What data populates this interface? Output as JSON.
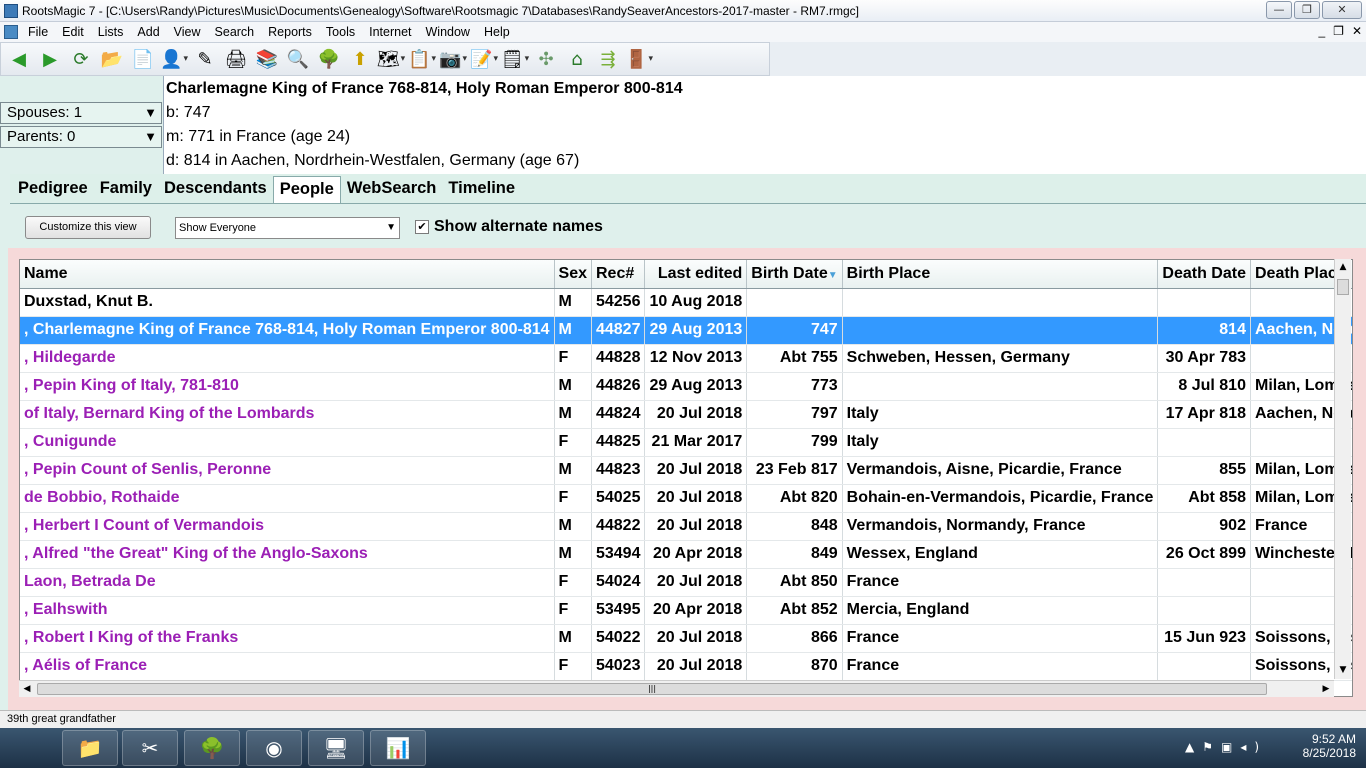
{
  "window": {
    "title": "RootsMagic 7 - [C:\\Users\\Randy\\Pictures\\Music\\Documents\\Genealogy\\Software\\Rootsmagic 7\\Databases\\RandySeaverAncestors-2017-master - RM7.rmgc]",
    "minimize": "—",
    "maximize": "❐",
    "close": "✕"
  },
  "menu": [
    "File",
    "Edit",
    "Lists",
    "Add",
    "View",
    "Search",
    "Reports",
    "Tools",
    "Internet",
    "Window",
    "Help"
  ],
  "mdi_controls": [
    "_",
    "❐",
    "✕"
  ],
  "toolbar": [
    {
      "name": "back-icon",
      "glyph": "◀"
    },
    {
      "name": "forward-icon",
      "glyph": "▶"
    },
    {
      "name": "refresh-icon",
      "glyph": "⟳"
    },
    {
      "name": "open-folder-icon",
      "glyph": "📂"
    },
    {
      "name": "new-file-icon",
      "glyph": "📄"
    },
    {
      "name": "add-person-icon",
      "glyph": "👤"
    },
    {
      "name": "edit-person-icon",
      "glyph": "✎"
    },
    {
      "name": "print-icon",
      "glyph": "🖨"
    },
    {
      "name": "books-icon",
      "glyph": "📚"
    },
    {
      "name": "search-icon",
      "glyph": "🔍"
    },
    {
      "name": "tree-icon",
      "glyph": "🌳"
    },
    {
      "name": "signpost-icon",
      "glyph": "⬆"
    },
    {
      "name": "map-icon",
      "glyph": "🗺"
    },
    {
      "name": "report-icon",
      "glyph": "📋"
    },
    {
      "name": "media-icon",
      "glyph": "📷"
    },
    {
      "name": "form-icon",
      "glyph": "📝"
    },
    {
      "name": "note-icon",
      "glyph": "🗒"
    },
    {
      "name": "pedigree-icon",
      "glyph": "✣"
    },
    {
      "name": "home-icon",
      "glyph": "⌂"
    },
    {
      "name": "tools-icon",
      "glyph": "⇶"
    },
    {
      "name": "exit-icon",
      "glyph": "🚪"
    }
  ],
  "left_pane": {
    "spouses": "Spouses: 1",
    "parents": "Parents: 0"
  },
  "person": {
    "name": "Charlemagne  King of France 768-814, Holy Roman Emperor 800-814",
    "birth": "b: 747",
    "marriage": "m: 771 in France (age 24)",
    "death": "d: 814 in Aachen, Nordrhein-Westfalen, Germany (age 67)"
  },
  "tabs": [
    "Pedigree",
    "Family",
    "Descendants",
    "People",
    "WebSearch",
    "Timeline"
  ],
  "active_tab": "People",
  "options": {
    "customize_button": "Customize this view",
    "show_select": "Show Everyone",
    "show_alternate": "Show alternate names"
  },
  "grid": {
    "columns": [
      "Name",
      "Sex",
      "Rec#",
      "Last edited",
      "Birth Date",
      "Birth Place",
      "Death Date",
      "Death Place"
    ],
    "rows": [
      [
        "Duxstad, Knut B.",
        "M",
        "54256",
        "10 Aug 2018",
        "",
        "",
        "",
        ""
      ],
      [
        ", Charlemagne King of France 768-814, Holy Roman Emperor 800-814",
        "M",
        "44827",
        "29 Aug 2013",
        "747",
        "",
        "814",
        "Aachen, Nordrhein-Westfalen, Germany"
      ],
      [
        ", Hildegarde",
        "F",
        "44828",
        "12 Nov 2013",
        "Abt 755",
        "Schweben, Hessen, Germany",
        "30 Apr 783",
        ""
      ],
      [
        ", Pepin King of Italy, 781-810",
        "M",
        "44826",
        "29 Aug 2013",
        "773",
        "",
        "8 Jul 810",
        "Milan, Lombardia, Italy"
      ],
      [
        "of Italy, Bernard King of the Lombards",
        "M",
        "44824",
        "20 Jul 2018",
        "797",
        "Italy",
        "17 Apr 818",
        "Aachen, Nordrhein-Westfalen, Germany"
      ],
      [
        ", Cunigunde",
        "F",
        "44825",
        "21 Mar 2017",
        "799",
        "Italy",
        "",
        ""
      ],
      [
        ", Pepin Count of Senlis, Peronne",
        "M",
        "44823",
        "20 Jul 2018",
        "23 Feb 817",
        "Vermandois, Aisne, Picardie, France",
        "855",
        "Milan, Lombardia, Italy"
      ],
      [
        "de Bobbio, Rothaide",
        "F",
        "54025",
        "20 Jul 2018",
        "Abt 820",
        "Bohain-en-Vermandois, Picardie, France",
        "Abt 858",
        "Milan, Lombardia, Italy"
      ],
      [
        ", Herbert I Count of Vermandois",
        "M",
        "44822",
        "20 Jul 2018",
        "848",
        "Vermandois, Normandy, France",
        "902",
        "France"
      ],
      [
        ", Alfred \"the Great\" King of the Anglo-Saxons",
        "M",
        "53494",
        "20 Apr 2018",
        "849",
        "Wessex, England",
        "26 Oct 899",
        "Winchester, Hampshire, England"
      ],
      [
        "Laon, Betrada De",
        "F",
        "54024",
        "20 Jul 2018",
        "Abt 850",
        "France",
        "",
        ""
      ],
      [
        ", Ealhswith",
        "F",
        "53495",
        "20 Apr 2018",
        "Abt 852",
        "Mercia, England",
        "",
        ""
      ],
      [
        ", Robert I King of the Franks",
        "M",
        "54022",
        "20 Jul 2018",
        "866",
        "France",
        "15 Jun 923",
        "Soissons, Aisne, Hauts-de-France, France"
      ],
      [
        ", Aélis of France",
        "F",
        "54023",
        "20 Jul 2018",
        "870",
        "France",
        "",
        "Soissons, Aisne, Picardie, France"
      ]
    ],
    "selected_row": 1
  },
  "status": "39th great grandfather",
  "taskbar": {
    "time": "9:52 AM",
    "date": "8/25/2018"
  },
  "colors": {
    "accent_selection": "#3399ff",
    "name_purple": "#9b1fb5",
    "pane_bg": "#ddf0ea",
    "grid_frame": "#f6d9d9"
  }
}
